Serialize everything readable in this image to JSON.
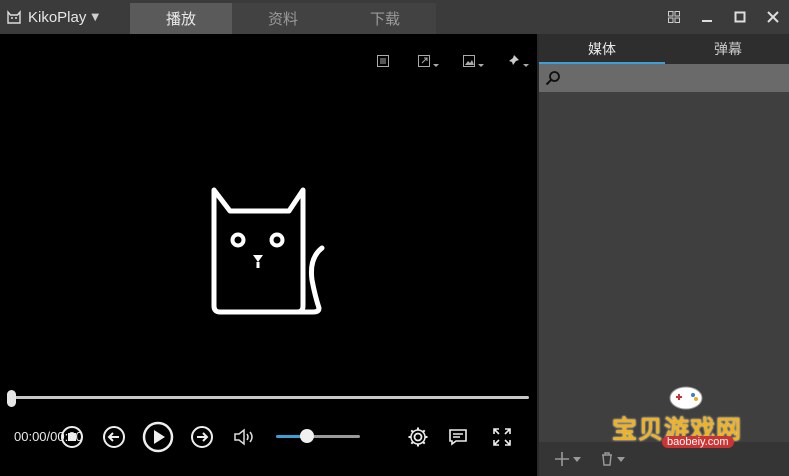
{
  "app": {
    "name": "KikoPlay"
  },
  "tabs": [
    {
      "label": "播放",
      "active": true
    },
    {
      "label": "资料",
      "active": false
    },
    {
      "label": "下载",
      "active": false
    }
  ],
  "window": {
    "icons": [
      "grid-icon",
      "minimize-icon",
      "maximize-icon",
      "close-icon"
    ]
  },
  "player": {
    "time_display": "00:00/00:00",
    "top_icons": [
      "playlist-icon",
      "external-link-icon",
      "screenshot-icon",
      "pin-icon"
    ],
    "volume_level": 0.34,
    "seek_progress": 0,
    "colors": {
      "accent": "#3e9ed6"
    }
  },
  "side": {
    "tabs": [
      {
        "label": "媒体",
        "active": true
      },
      {
        "label": "弹幕",
        "active": false
      }
    ],
    "search": {
      "value": "",
      "placeholder": ""
    }
  },
  "watermark": {
    "title": "宝贝游戏网",
    "url": "baobeiy.com"
  }
}
